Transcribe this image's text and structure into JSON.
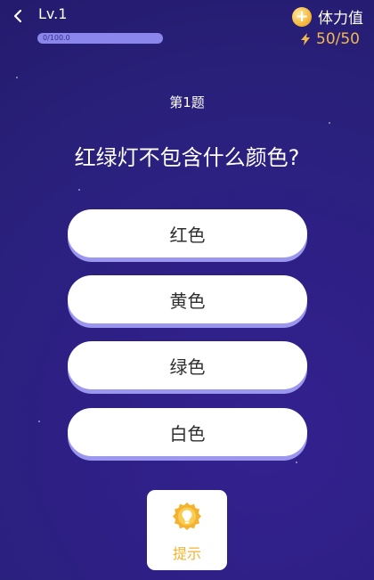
{
  "header": {
    "back_icon": "back-arrow-icon",
    "level": "Lv.1",
    "progress": {
      "text": "0/100.0",
      "fraction": 0
    },
    "stamina": {
      "icon": "plus-coin-icon",
      "label": "体力值"
    },
    "energy": {
      "icon": "lightning-icon",
      "value": "50/50"
    }
  },
  "quiz": {
    "number": "第1题",
    "question": "红绿灯不包含什么颜色?",
    "answers": [
      "红色",
      "黄色",
      "绿色",
      "白色"
    ]
  },
  "hint": {
    "icon": "lightbulb-badge-icon",
    "label": "提示"
  },
  "colors": {
    "background": "#2e1f86",
    "answer_bg": "#ffffff",
    "answer_shadow": "#9b97ef",
    "accent": "#f1b84d",
    "progress_track": "#8a86ec"
  }
}
